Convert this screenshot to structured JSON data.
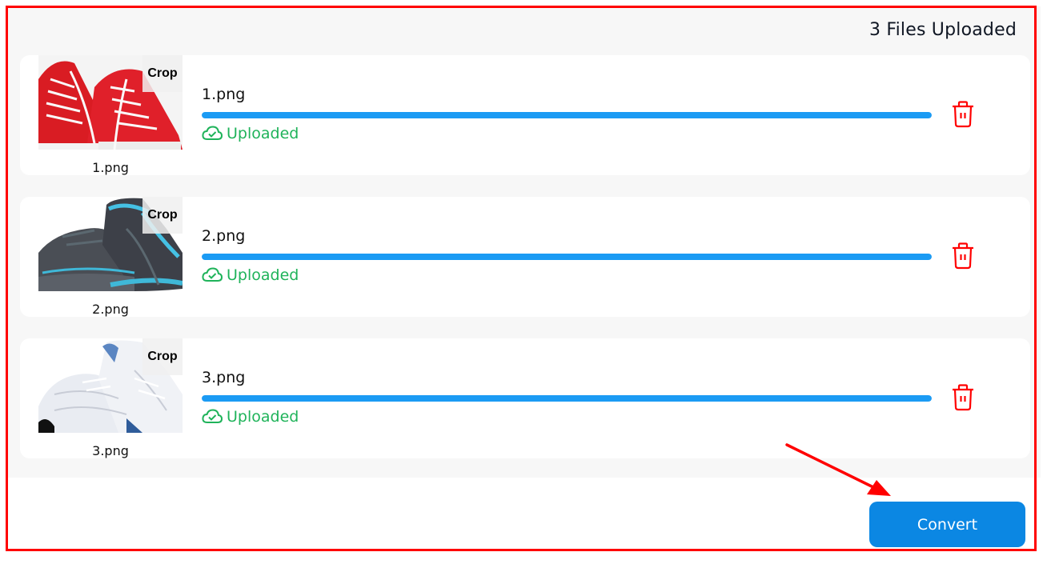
{
  "header": {
    "files_uploaded_label": "3 Files Uploaded"
  },
  "colors": {
    "progress": "#1b9bf4",
    "status_success": "#1fb35a",
    "delete": "#ff0000",
    "primary_button": "#0b87e3",
    "annotation": "#ff0000"
  },
  "files": [
    {
      "name": "1.png",
      "caption": "1.png",
      "crop_label": "Crop",
      "status": "Uploaded",
      "progress_percent": 100,
      "status_icon": "cloud-check-icon",
      "delete_icon": "trash-icon",
      "thumbnail": "red-high-top-sneakers"
    },
    {
      "name": "2.png",
      "caption": "2.png",
      "crop_label": "Crop",
      "status": "Uploaded",
      "progress_percent": 100,
      "status_icon": "cloud-check-icon",
      "delete_icon": "trash-icon",
      "thumbnail": "grey-blue-running-shoes"
    },
    {
      "name": "3.png",
      "caption": "3.png",
      "crop_label": "Crop",
      "status": "Uploaded",
      "progress_percent": 100,
      "status_icon": "cloud-check-icon",
      "delete_icon": "trash-icon",
      "thumbnail": "white-blue-running-shoes"
    }
  ],
  "footer": {
    "convert_label": "Convert"
  }
}
